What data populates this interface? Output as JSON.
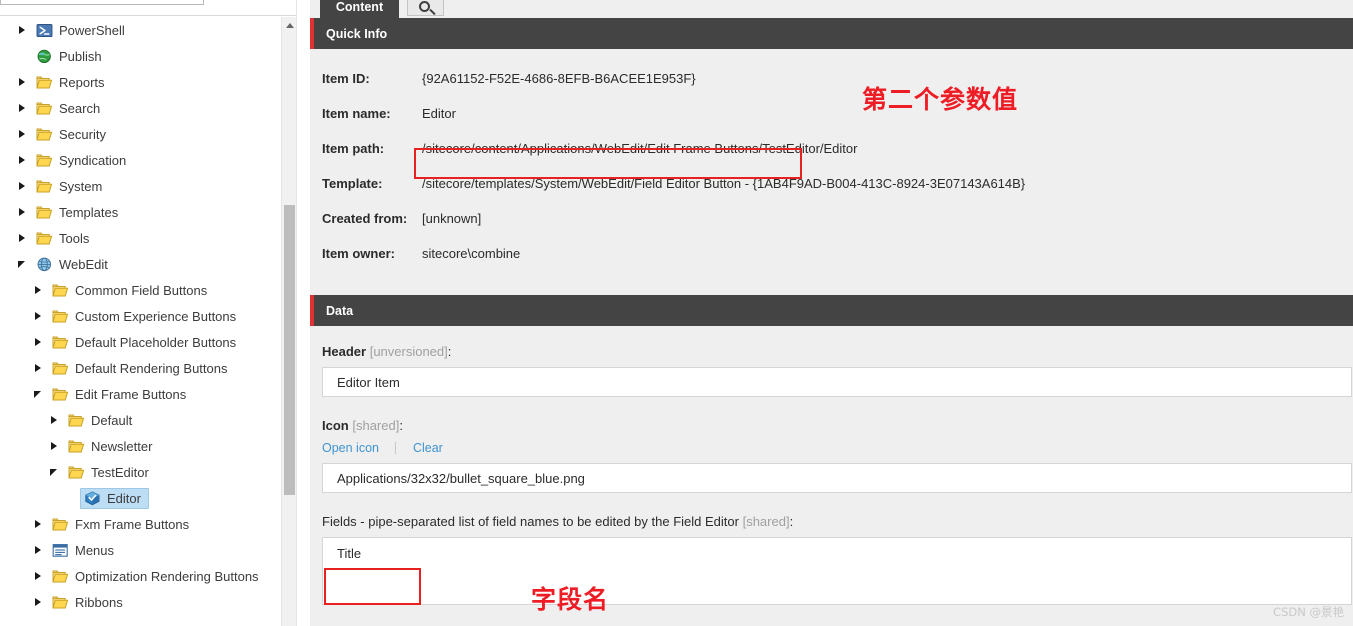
{
  "app": {
    "watermark": "CSDN @景艳"
  },
  "left_pane": {
    "search": {
      "value": "",
      "placeholder": ""
    },
    "scrollbar": {
      "name": "tree-vertical-scrollbar"
    },
    "tree": [
      {
        "label": "PowerShell",
        "indent": 1,
        "arrow": "collapsed",
        "icon": "powershell-icon",
        "selected": false
      },
      {
        "label": "Publish",
        "indent": 1,
        "arrow": "none",
        "icon": "globe-icon",
        "selected": false
      },
      {
        "label": "Reports",
        "indent": 1,
        "arrow": "collapsed",
        "icon": "folder-icon",
        "selected": false
      },
      {
        "label": "Search",
        "indent": 1,
        "arrow": "collapsed",
        "icon": "folder-icon",
        "selected": false
      },
      {
        "label": "Security",
        "indent": 1,
        "arrow": "collapsed",
        "icon": "folder-icon",
        "selected": false
      },
      {
        "label": "Syndication",
        "indent": 1,
        "arrow": "collapsed",
        "icon": "folder-icon",
        "selected": false
      },
      {
        "label": "System",
        "indent": 1,
        "arrow": "collapsed",
        "icon": "folder-icon",
        "selected": false
      },
      {
        "label": "Templates",
        "indent": 1,
        "arrow": "collapsed",
        "icon": "folder-icon",
        "selected": false
      },
      {
        "label": "Tools",
        "indent": 1,
        "arrow": "collapsed",
        "icon": "folder-icon",
        "selected": false
      },
      {
        "label": "WebEdit",
        "indent": 1,
        "arrow": "expanded",
        "icon": "globe-blue-icon",
        "selected": false
      },
      {
        "label": "Common Field Buttons",
        "indent": 2,
        "arrow": "collapsed",
        "icon": "folder-icon",
        "selected": false
      },
      {
        "label": "Custom Experience Buttons",
        "indent": 2,
        "arrow": "collapsed",
        "icon": "folder-icon",
        "selected": false
      },
      {
        "label": "Default Placeholder Buttons",
        "indent": 2,
        "arrow": "collapsed",
        "icon": "folder-icon",
        "selected": false
      },
      {
        "label": "Default Rendering Buttons",
        "indent": 2,
        "arrow": "collapsed",
        "icon": "folder-icon",
        "selected": false
      },
      {
        "label": "Edit Frame Buttons",
        "indent": 2,
        "arrow": "expanded",
        "icon": "folder-icon",
        "selected": false
      },
      {
        "label": "Default",
        "indent": 3,
        "arrow": "collapsed",
        "icon": "folder-icon",
        "selected": false
      },
      {
        "label": "Newsletter",
        "indent": 3,
        "arrow": "collapsed",
        "icon": "folder-icon",
        "selected": false
      },
      {
        "label": "TestEditor",
        "indent": 3,
        "arrow": "expanded",
        "icon": "folder-icon",
        "selected": false
      },
      {
        "label": "Editor",
        "indent": 4,
        "arrow": "none",
        "icon": "blue-box-icon",
        "selected": true
      },
      {
        "label": "Fxm Frame Buttons",
        "indent": 2,
        "arrow": "collapsed",
        "icon": "folder-icon",
        "selected": false
      },
      {
        "label": "Menus",
        "indent": 2,
        "arrow": "collapsed",
        "icon": "menu-icon",
        "selected": false
      },
      {
        "label": "Optimization Rendering Buttons",
        "indent": 2,
        "arrow": "collapsed",
        "icon": "folder-icon",
        "selected": false
      },
      {
        "label": "Ribbons",
        "indent": 2,
        "arrow": "collapsed",
        "icon": "folder-icon",
        "selected": false
      }
    ]
  },
  "right_pane": {
    "tabs": [
      {
        "label": "Content",
        "active": true
      }
    ],
    "search_button": {
      "icon": "search-icon"
    },
    "quick_info": {
      "title": "Quick Info",
      "rows": [
        {
          "label": "Item ID:",
          "value": "{92A61152-F52E-4686-8EFB-B6ACEE1E953F}"
        },
        {
          "label": "Item name:",
          "value": "Editor"
        },
        {
          "label": "Item path:",
          "value": "/sitecore/content/Applications/WebEdit/Edit Frame Buttons/TestEditor/Editor"
        },
        {
          "label": "Template:",
          "value": "/sitecore/templates/System/WebEdit/Field Editor Button - {1AB4F9AD-B004-413C-8924-3E07143A614B}"
        },
        {
          "label": "Created from:",
          "value": "[unknown]"
        },
        {
          "label": "Item owner:",
          "value": "sitecore\\combine"
        }
      ]
    },
    "data": {
      "title": "Data",
      "header_field": {
        "label_main": "Header",
        "label_qualifier": "[unversioned]",
        "label_suffix": ":",
        "value": "Editor Item"
      },
      "icon_field": {
        "label_main": "Icon",
        "label_qualifier": "[shared]",
        "label_suffix": ":",
        "link_open": "Open icon",
        "link_clear": "Clear",
        "value": "Applications/32x32/bullet_square_blue.png"
      },
      "fields_field": {
        "label_main": "Fields - pipe-separated list of field names to be edited by the Field Editor",
        "label_qualifier": "[shared]",
        "label_suffix": ":",
        "value": "Title"
      }
    }
  },
  "annotations": {
    "second_param": "第二个参数值",
    "field_name": "字段名"
  },
  "colors": {
    "section_header_bg": "#444444",
    "accent_red": "#e03131",
    "annotation_red": "#ee1c24",
    "link_blue": "#3f93d1",
    "selection_blue": "#bcddf4",
    "body_bg": "#efefef"
  }
}
